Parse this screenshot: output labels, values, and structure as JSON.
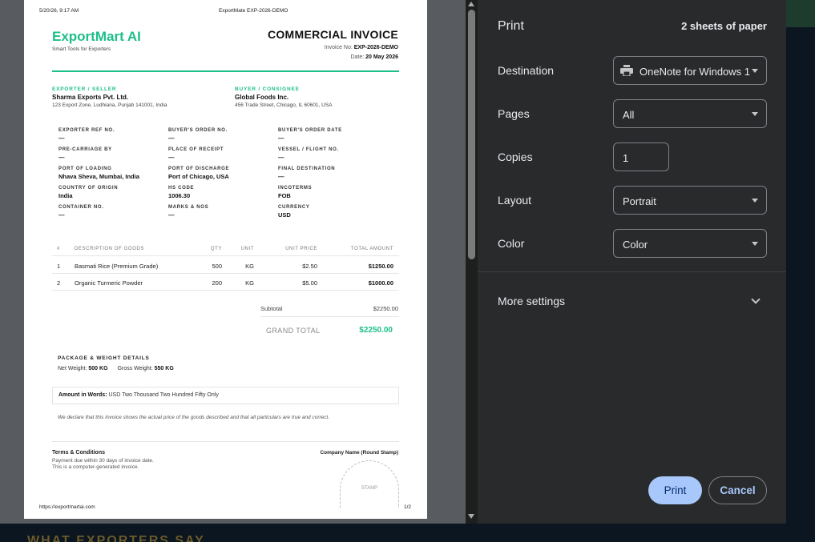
{
  "preview": {
    "header_left": "5/20/26, 9:17 AM",
    "header_center": "ExportMate  EXP-2026-DEMO",
    "footer_left": "https://exportmartai.com",
    "footer_right": "1/2",
    "invoice": {
      "brand": "ExportMart AI",
      "tagline": "Smart Tools for Exporters",
      "title": "COMMERCIAL INVOICE",
      "invoice_no_label": "Invoice No: ",
      "invoice_no": "EXP-2026-DEMO",
      "date_label": "Date: ",
      "date": "20 May 2026",
      "exporter": {
        "label": "EXPORTER / SELLER",
        "name": "Sharma Exports Pvt. Ltd.",
        "address": "123 Export Zone, Ludhiana, Punjab 141001, India"
      },
      "buyer": {
        "label": "BUYER / CONSIGNEE",
        "name": "Global Foods Inc.",
        "address": "456 Trade Street, Chicago, IL 60601, USA"
      },
      "fields": [
        {
          "label": "EXPORTER REF NO.",
          "value": "—"
        },
        {
          "label": "BUYER'S ORDER NO.",
          "value": "—"
        },
        {
          "label": "BUYER'S ORDER DATE",
          "value": "—"
        },
        {
          "label": "PRE-CARRIAGE BY",
          "value": "—"
        },
        {
          "label": "PLACE OF RECEIPT",
          "value": "—"
        },
        {
          "label": "VESSEL / FLIGHT NO.",
          "value": "—"
        },
        {
          "label": "PORT OF LOADING",
          "value": "Nhava Sheva, Mumbai, India"
        },
        {
          "label": "PORT OF DISCHARGE",
          "value": "Port of Chicago, USA"
        },
        {
          "label": "FINAL DESTINATION",
          "value": "—"
        },
        {
          "label": "COUNTRY OF ORIGIN",
          "value": "India"
        },
        {
          "label": "HS CODE",
          "value": "1006.30"
        },
        {
          "label": "INCOTERMS",
          "value": "FOB"
        },
        {
          "label": "CONTAINER NO.",
          "value": "—"
        },
        {
          "label": "MARKS & NOS",
          "value": "—"
        },
        {
          "label": "CURRENCY",
          "value": "USD"
        }
      ],
      "table": {
        "columns": [
          "#",
          "DESCRIPTION OF GOODS",
          "QTY",
          "UNIT",
          "UNIT PRICE",
          "TOTAL AMOUNT"
        ],
        "rows": [
          [
            "1",
            "Basmati Rice (Premium Grade)",
            "500",
            "KG",
            "$2.50",
            "$1250.00"
          ],
          [
            "2",
            "Organic Turmeric Powder",
            "200",
            "KG",
            "$5.00",
            "$1000.00"
          ]
        ]
      },
      "subtotal_label": "Subtotal",
      "subtotal": "$2250.00",
      "grand_total_label": "GRAND TOTAL",
      "grand_total": "$2250.00",
      "package_title": "PACKAGE & WEIGHT DETAILS",
      "net_weight_label": "Net Weight: ",
      "net_weight": "500 KG",
      "gross_weight_label": "Gross Weight: ",
      "gross_weight": "550 KG",
      "amount_words_label": "Amount in Words: ",
      "amount_words": "USD Two Thousand Two Hundred Fifty Only",
      "declaration": "We declare that this Invoice shows the actual price of the goods described and that all particulars are true and correct.",
      "terms_title": "Terms & Conditions",
      "terms_lines": [
        "Payment due within 30 days of invoice date.",
        "This is a computer-generated invoice."
      ],
      "company_stamp_label": "Company Name (Round Stamp)",
      "stamp_text": "STAMP"
    }
  },
  "print_panel": {
    "title": "Print",
    "sheets": "2 sheets of paper",
    "destination_label": "Destination",
    "destination_value": "OneNote for Windows 1",
    "destination_icon": "printer-icon",
    "pages_label": "Pages",
    "pages_value": "All",
    "copies_label": "Copies",
    "copies_value": "1",
    "layout_label": "Layout",
    "layout_value": "Portrait",
    "color_label": "Color",
    "color_value": "Color",
    "more_settings": "More settings",
    "print_button": "Print",
    "cancel_button": "Cancel",
    "accent": "#a8c7fa"
  },
  "background_page": {
    "peek_text": "WHAT EXPORTERS SAY"
  }
}
